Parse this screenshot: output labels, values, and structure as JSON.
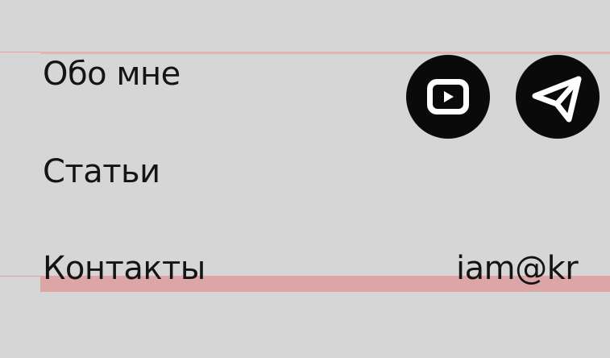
{
  "nav": {
    "items": [
      {
        "label": "Обо мне"
      },
      {
        "label": "Статьи"
      },
      {
        "label": "Контакты"
      }
    ]
  },
  "contact": {
    "email": "iam@kr"
  },
  "social": {
    "items": [
      {
        "icon": "youtube-icon"
      },
      {
        "icon": "telegram-icon"
      }
    ]
  },
  "colors": {
    "background": "#d6d6d6",
    "text": "#141414",
    "icon_bg": "#0a0a0a",
    "highlight": "#dca6a6",
    "guide": "#e8a0a0"
  }
}
